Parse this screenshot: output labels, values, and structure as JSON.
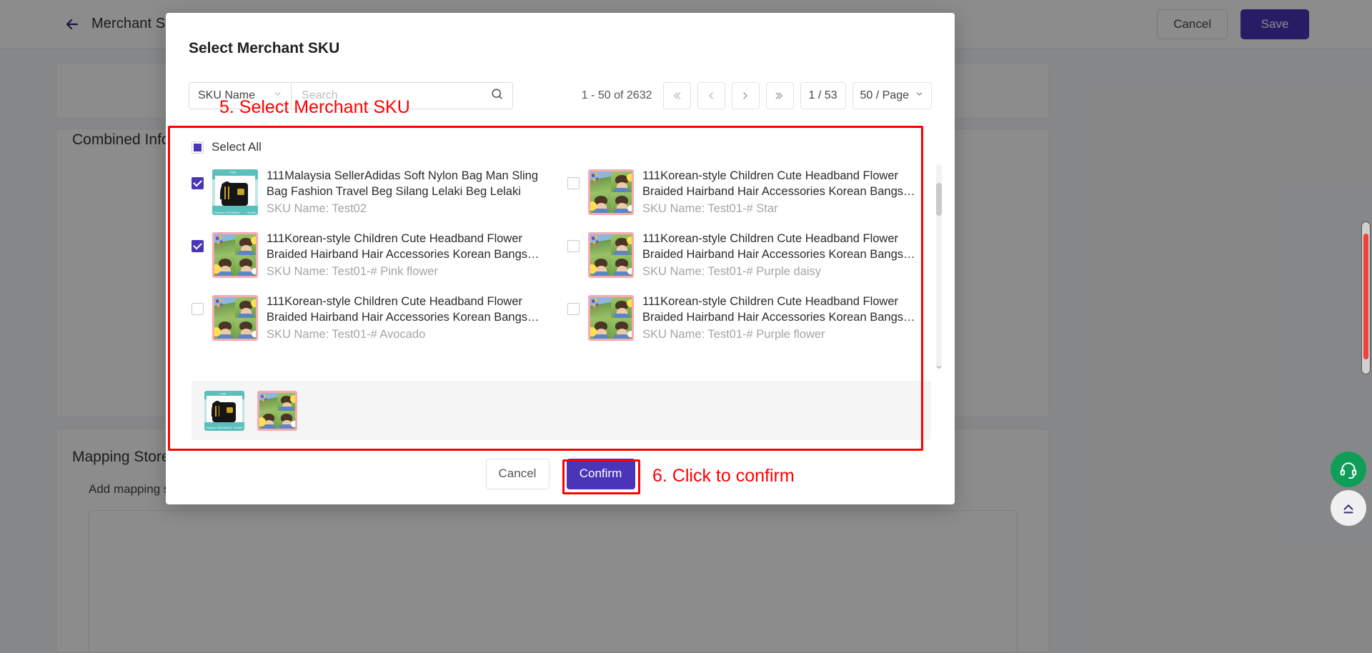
{
  "background": {
    "breadcrumb": "Merchant SKU · Add Combination SKU",
    "back_icon": "arrow-left-icon",
    "cancel_label": "Cancel",
    "save_label": "Save",
    "section_combined": "Combined Information",
    "section_mapping": "Mapping Store SKU",
    "mapping_hint": "Add mapping store SKU",
    "support_icon": "headset-icon",
    "scroll_to_top_icon": "chevron-up-icon"
  },
  "modal": {
    "title": "Select Merchant SKU",
    "filter_field": {
      "selected": "SKU Name",
      "chevron_icon": "chevron-down-icon"
    },
    "search": {
      "value": "",
      "placeholder": "Search",
      "icon": "search-icon"
    },
    "pagination": {
      "range_text": "1 - 50 of 2632",
      "first_icon": "double-chevron-left-icon",
      "prev_icon": "chevron-left-icon",
      "next_icon": "chevron-right-icon",
      "last_icon": "double-chevron-right-icon",
      "page_indicator": "1 / 53",
      "page_size": "50 / Page",
      "page_size_chevron": "chevron-down-icon"
    },
    "select_all_label": "Select All",
    "select_all_state": "indeterminate",
    "items": [
      {
        "checked": true,
        "art": "bag",
        "title": "111Malaysia SellerAdidas Soft Nylon Bag Man Sling Bag Fashion Travel Beg Silang Lelaki Beg Lelaki",
        "sku_name": "SKU Name: Test02"
      },
      {
        "checked": false,
        "art": "girl",
        "title": "111Korean-style Children Cute Headband Flower Braided Hairband Hair Accessories Korean Bangs Hair...",
        "sku_name": "SKU Name: Test01-# Star"
      },
      {
        "checked": true,
        "art": "girl",
        "title": "111Korean-style Children Cute Headband Flower Braided Hairband Hair Accessories Korean Bangs Hair...",
        "sku_name": "SKU Name: Test01-# Pink flower"
      },
      {
        "checked": false,
        "art": "girl",
        "title": "111Korean-style Children Cute Headband Flower Braided Hairband Hair Accessories Korean Bangs Hair...",
        "sku_name": "SKU Name: Test01-# Purple daisy"
      },
      {
        "checked": false,
        "art": "girl",
        "title": "111Korean-style Children Cute Headband Flower Braided Hairband Hair Accessories Korean Bangs Hair...",
        "sku_name": "SKU Name: Test01-# Avocado"
      },
      {
        "checked": false,
        "art": "girl",
        "title": "111Korean-style Children Cute Headband Flower Braided Hairband Hair Accessories Korean Bangs Hair...",
        "sku_name": "SKU Name: Test01-# Purple flower"
      }
    ],
    "selected_tray": [
      {
        "art": "bag"
      },
      {
        "art": "girl"
      }
    ],
    "footer": {
      "cancel_label": "Cancel",
      "confirm_label": "Confirm"
    }
  },
  "annotations": {
    "step5": "5. Select Merchant SKU",
    "step6": "6. Click to confirm",
    "color": "#ff0000"
  }
}
